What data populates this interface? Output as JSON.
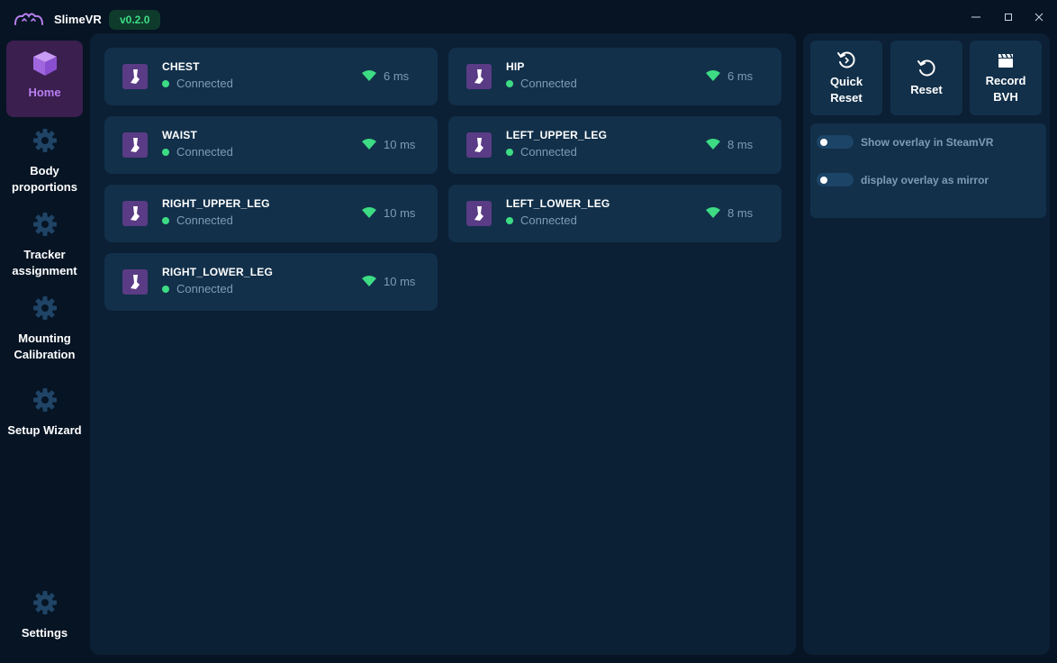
{
  "app": {
    "title": "SlimeVR",
    "version": "v0.2.0"
  },
  "sidebar": {
    "items": [
      {
        "label1": "Home",
        "label2": "",
        "icon": "cube-icon",
        "active": true
      },
      {
        "label1": "Body",
        "label2": "proportions",
        "icon": "gear-icon"
      },
      {
        "label1": "Tracker",
        "label2": "assignment",
        "icon": "gear-icon"
      },
      {
        "label1": "Mounting",
        "label2": "Calibration",
        "icon": "gear-icon"
      },
      {
        "label1": "Setup Wizard",
        "label2": "",
        "icon": "gear-icon"
      },
      {
        "label1": "Settings",
        "label2": "",
        "icon": "gear-icon"
      }
    ]
  },
  "trackers": [
    {
      "name": "CHEST",
      "status": "Connected",
      "ping": "6 ms"
    },
    {
      "name": "HIP",
      "status": "Connected",
      "ping": "6 ms"
    },
    {
      "name": "WAIST",
      "status": "Connected",
      "ping": "10 ms"
    },
    {
      "name": "LEFT_UPPER_LEG",
      "status": "Connected",
      "ping": "8 ms"
    },
    {
      "name": "RIGHT_UPPER_LEG",
      "status": "Connected",
      "ping": "10 ms"
    },
    {
      "name": "LEFT_LOWER_LEG",
      "status": "Connected",
      "ping": "8 ms"
    },
    {
      "name": "RIGHT_LOWER_LEG",
      "status": "Connected",
      "ping": "10 ms"
    }
  ],
  "actions": {
    "quick_reset": {
      "line1": "Quick",
      "line2": "Reset"
    },
    "reset": {
      "label": "Reset"
    },
    "record": {
      "line1": "Record",
      "line2": "BVH"
    }
  },
  "overlay": {
    "show_steamvr": {
      "label": "Show overlay in SteamVR",
      "enabled": false
    },
    "mirror": {
      "label": "display overlay as mirror",
      "enabled": false
    }
  },
  "colors": {
    "background": "#061424",
    "panel": "#0b1f35",
    "card": "#12304a",
    "accent_purple": "#b87ff0",
    "connected_green": "#3ddc84",
    "muted_text": "#7f9bb5"
  }
}
